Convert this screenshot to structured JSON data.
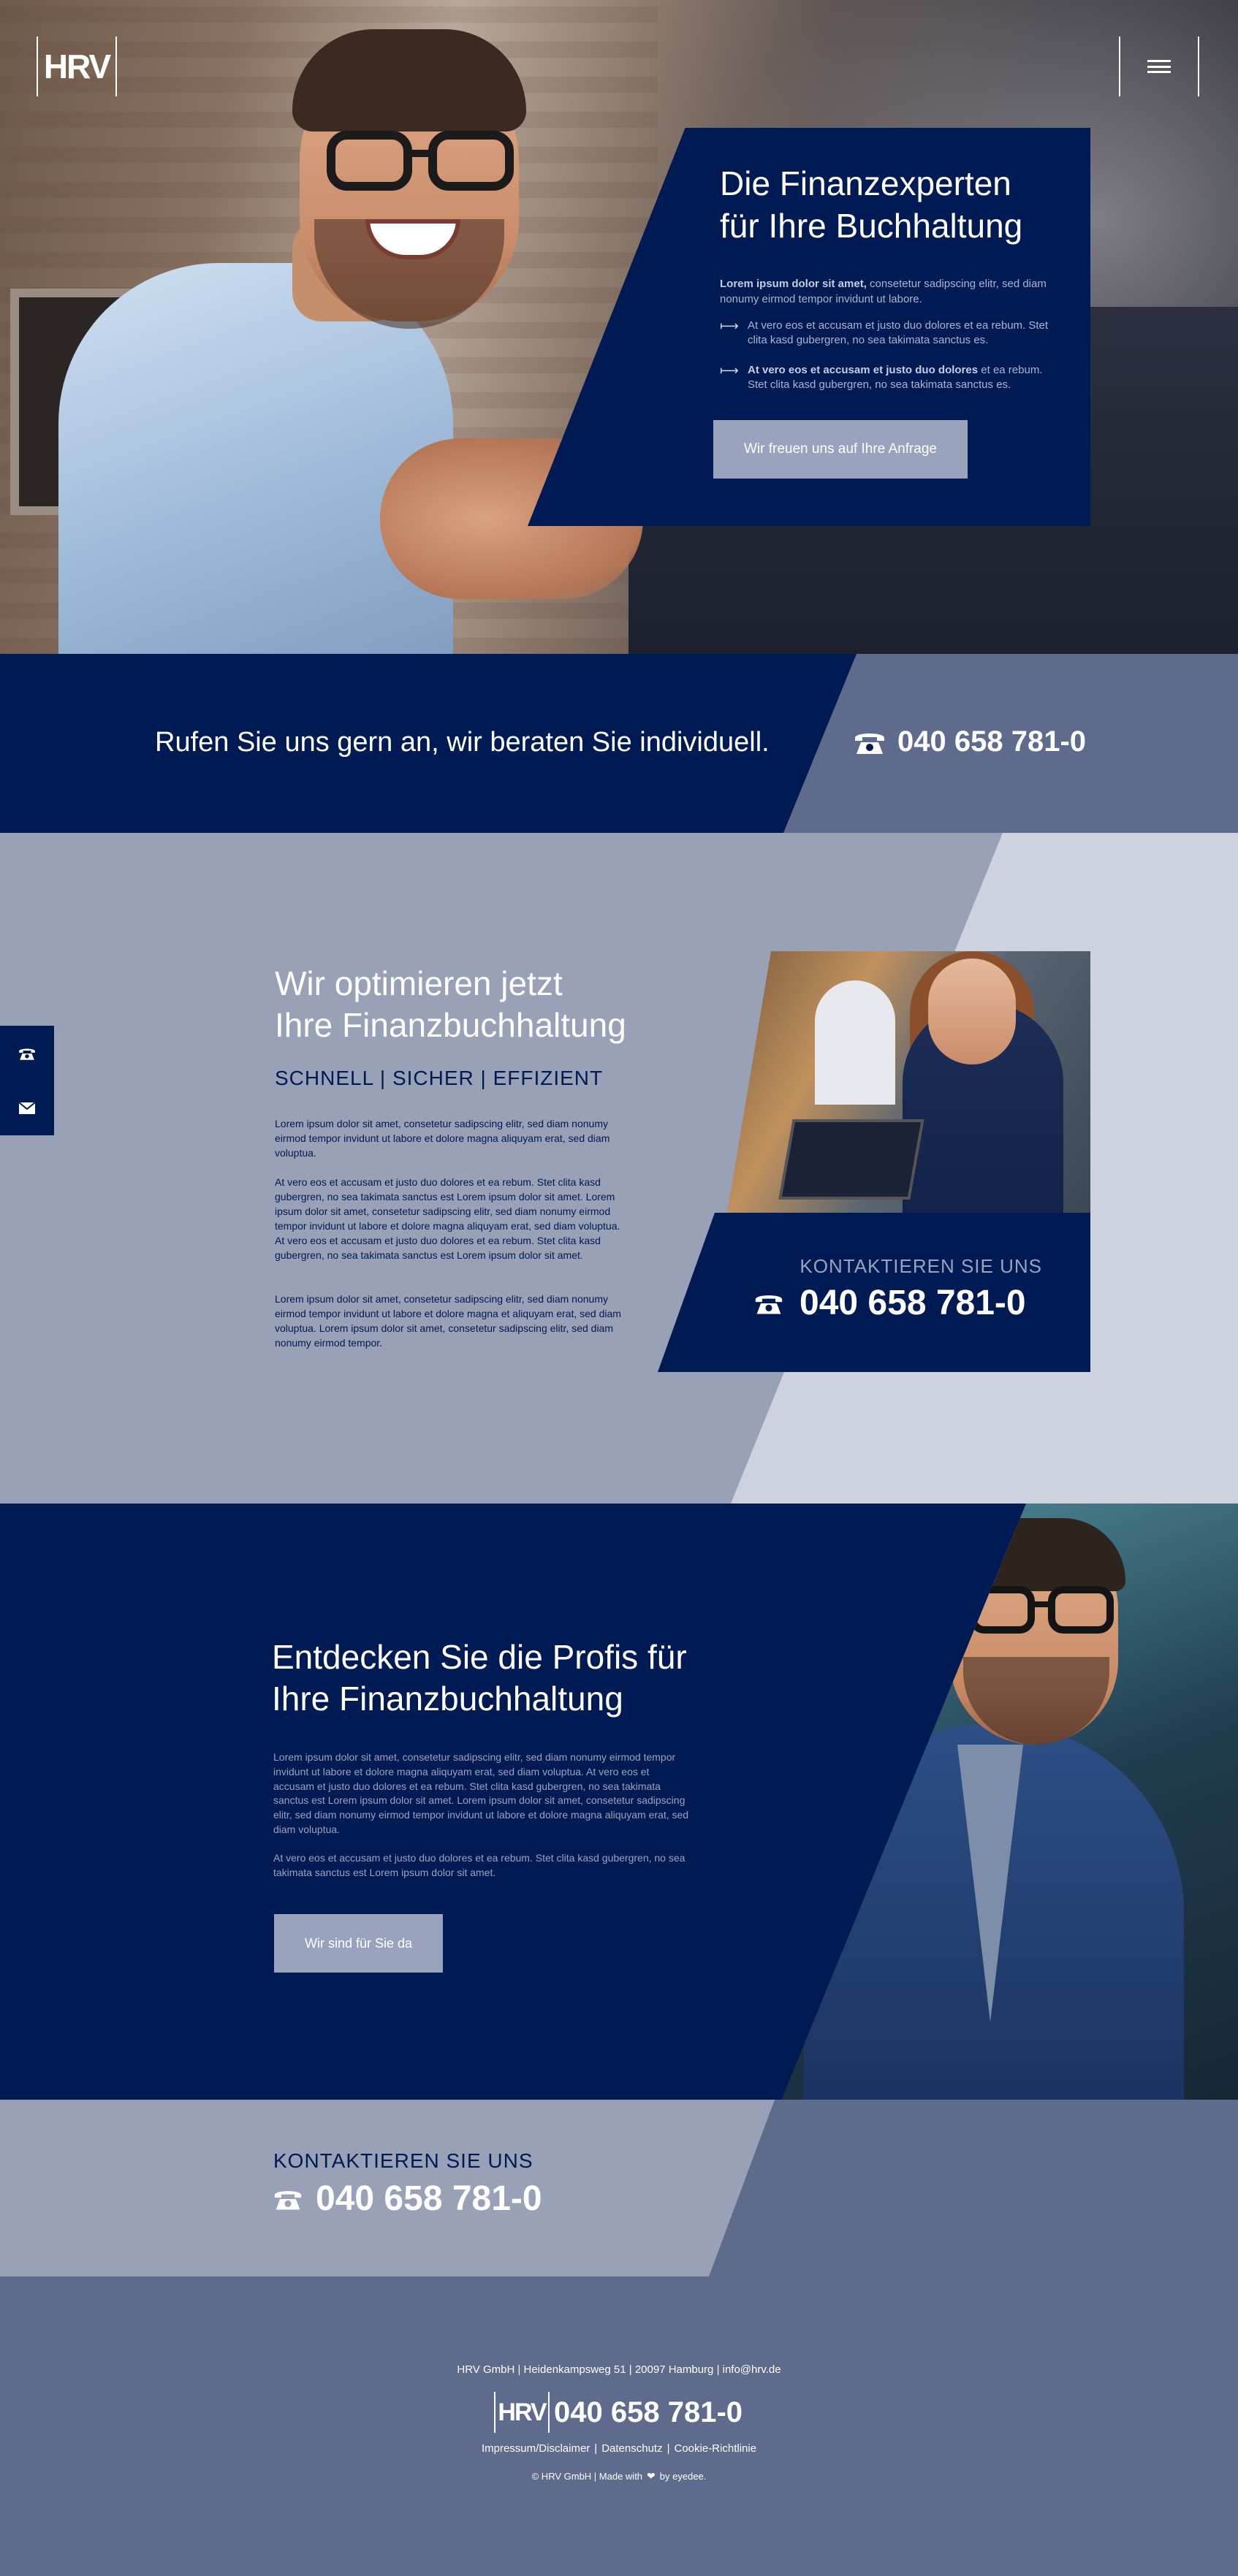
{
  "brand": {
    "logo": "HRV"
  },
  "header": {
    "menu_icon": "hamburger-icon"
  },
  "hero": {
    "title_line1": "Die Finanzexperten",
    "title_line2": "für Ihre Buchhaltung",
    "intro_bold": "Lorem ipsum dolor sit amet,",
    "intro_rest": " consetetur sadipscing elitr, sed diam nonumy eirmod tempor invidunt ut labore.",
    "bullets": [
      {
        "bold": "",
        "text": "At vero eos et accusam et justo duo dolores et ea rebum. Stet clita kasd gubergren, no sea takimata sanctus es."
      },
      {
        "bold": "At vero eos et accusam et justo duo dolores",
        "text": " et ea rebum. Stet clita kasd gubergren, no sea takimata sanctus es."
      }
    ],
    "cta_label": "Wir freuen uns auf Ihre Anfrage"
  },
  "callbar": {
    "text": "Rufen Sie uns gern an, wir beraten Sie individuell.",
    "phone": "040 658 781-0",
    "phone_icon": "telephone-icon"
  },
  "optimize": {
    "title_line1": "Wir optimieren jetzt",
    "title_line2": "Ihre Finanzbuchhaltung",
    "subtitle": "SCHNELL | SICHER | EFFIZIENT",
    "paragraphs": [
      "Lorem ipsum dolor sit amet, consetetur sadipscing elitr, sed diam nonumy eirmod tempor invidunt ut labore et dolore magna aliquyam erat, sed diam voluptua.",
      "At vero eos et accusam et justo duo dolores et ea rebum. Stet clita kasd gubergren, no sea takimata sanctus est Lorem ipsum dolor sit amet. Lorem ipsum dolor sit amet, consetetur sadipscing elitr, sed diam nonumy eirmod tempor invidunt ut labore et dolore magna aliquyam erat, sed diam voluptua. At vero eos et accusam et justo duo dolores et ea rebum. Stet clita kasd gubergren, no sea takimata sanctus est Lorem ipsum dolor sit amet.",
      "Lorem ipsum dolor sit amet, consetetur sadipscing elitr, sed diam nonumy eirmod tempor invidunt ut labore et dolore magna et aliquyam erat, sed diam voluptua. Lorem ipsum dolor sit amet, consetetur sadipscing elitr, sed diam nonumy eirmod tempor."
    ],
    "contact_label": "KONTAKTIEREN SIE UNS",
    "contact_phone": "040 658 781-0"
  },
  "side_tabs": [
    {
      "name": "side-tab-phone",
      "icon": "telephone-icon"
    },
    {
      "name": "side-tab-mail",
      "icon": "envelope-icon"
    }
  ],
  "discover": {
    "title_line1": "Entdecken Sie die Profis für",
    "title_line2": "Ihre Finanzbuchhaltung",
    "paragraphs": [
      "Lorem ipsum dolor sit amet, consetetur sadipscing elitr, sed diam nonumy eirmod tempor invidunt ut labore et dolore magna aliquyam erat, sed diam voluptua. At vero eos et accusam et justo duo dolores et ea rebum. Stet clita kasd gubergren, no sea takimata sanctus est Lorem ipsum dolor sit amet. Lorem ipsum dolor sit amet, consetetur sadipscing elitr, sed diam nonumy eirmod tempor invidunt ut labore et dolore magna aliquyam erat, sed diam voluptua.",
      "At vero eos et accusam et justo duo dolores et ea rebum. Stet clita kasd gubergren, no sea takimata sanctus est Lorem ipsum dolor sit amet."
    ],
    "cta_label": "Wir sind für Sie da"
  },
  "contact_strip": {
    "label": "KONTAKTIEREN SIE UNS",
    "phone": "040 658 781-0"
  },
  "footer": {
    "address": "HRV GmbH | Heidenkampsweg 51 | 20097 Hamburg | info@hrv.de",
    "logo": "HRV",
    "phone": "040 658 781-0",
    "links": [
      "Impressum/Disclaimer",
      "Datenschutz",
      "Cookie-Richtlinie"
    ],
    "credit_prefix": "© HRV GmbH | Made with",
    "credit_suffix": "by eyedee.",
    "heart_icon": "heart-icon"
  },
  "colors": {
    "navy": "#001a54",
    "slate": "#5e6b8c",
    "gray_blue": "#98a1b5",
    "light": "#cdd2de",
    "button": "#9aa3bd"
  }
}
